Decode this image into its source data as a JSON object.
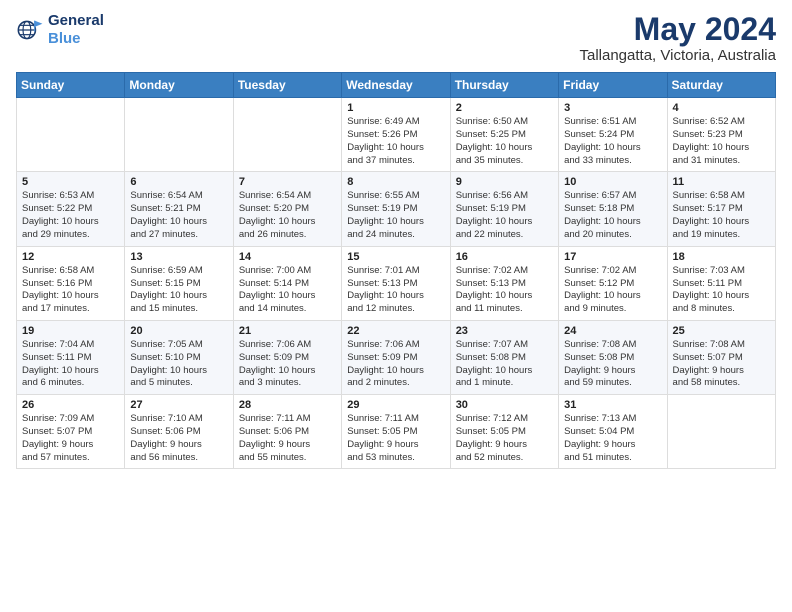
{
  "header": {
    "logo_line1": "General",
    "logo_line2": "Blue",
    "title": "May 2024",
    "subtitle": "Tallangatta, Victoria, Australia"
  },
  "calendar": {
    "days_of_week": [
      "Sunday",
      "Monday",
      "Tuesday",
      "Wednesday",
      "Thursday",
      "Friday",
      "Saturday"
    ],
    "weeks": [
      [
        {
          "day": "",
          "info": ""
        },
        {
          "day": "",
          "info": ""
        },
        {
          "day": "",
          "info": ""
        },
        {
          "day": "1",
          "info": "Sunrise: 6:49 AM\nSunset: 5:26 PM\nDaylight: 10 hours\nand 37 minutes."
        },
        {
          "day": "2",
          "info": "Sunrise: 6:50 AM\nSunset: 5:25 PM\nDaylight: 10 hours\nand 35 minutes."
        },
        {
          "day": "3",
          "info": "Sunrise: 6:51 AM\nSunset: 5:24 PM\nDaylight: 10 hours\nand 33 minutes."
        },
        {
          "day": "4",
          "info": "Sunrise: 6:52 AM\nSunset: 5:23 PM\nDaylight: 10 hours\nand 31 minutes."
        }
      ],
      [
        {
          "day": "5",
          "info": "Sunrise: 6:53 AM\nSunset: 5:22 PM\nDaylight: 10 hours\nand 29 minutes."
        },
        {
          "day": "6",
          "info": "Sunrise: 6:54 AM\nSunset: 5:21 PM\nDaylight: 10 hours\nand 27 minutes."
        },
        {
          "day": "7",
          "info": "Sunrise: 6:54 AM\nSunset: 5:20 PM\nDaylight: 10 hours\nand 26 minutes."
        },
        {
          "day": "8",
          "info": "Sunrise: 6:55 AM\nSunset: 5:19 PM\nDaylight: 10 hours\nand 24 minutes."
        },
        {
          "day": "9",
          "info": "Sunrise: 6:56 AM\nSunset: 5:19 PM\nDaylight: 10 hours\nand 22 minutes."
        },
        {
          "day": "10",
          "info": "Sunrise: 6:57 AM\nSunset: 5:18 PM\nDaylight: 10 hours\nand 20 minutes."
        },
        {
          "day": "11",
          "info": "Sunrise: 6:58 AM\nSunset: 5:17 PM\nDaylight: 10 hours\nand 19 minutes."
        }
      ],
      [
        {
          "day": "12",
          "info": "Sunrise: 6:58 AM\nSunset: 5:16 PM\nDaylight: 10 hours\nand 17 minutes."
        },
        {
          "day": "13",
          "info": "Sunrise: 6:59 AM\nSunset: 5:15 PM\nDaylight: 10 hours\nand 15 minutes."
        },
        {
          "day": "14",
          "info": "Sunrise: 7:00 AM\nSunset: 5:14 PM\nDaylight: 10 hours\nand 14 minutes."
        },
        {
          "day": "15",
          "info": "Sunrise: 7:01 AM\nSunset: 5:13 PM\nDaylight: 10 hours\nand 12 minutes."
        },
        {
          "day": "16",
          "info": "Sunrise: 7:02 AM\nSunset: 5:13 PM\nDaylight: 10 hours\nand 11 minutes."
        },
        {
          "day": "17",
          "info": "Sunrise: 7:02 AM\nSunset: 5:12 PM\nDaylight: 10 hours\nand 9 minutes."
        },
        {
          "day": "18",
          "info": "Sunrise: 7:03 AM\nSunset: 5:11 PM\nDaylight: 10 hours\nand 8 minutes."
        }
      ],
      [
        {
          "day": "19",
          "info": "Sunrise: 7:04 AM\nSunset: 5:11 PM\nDaylight: 10 hours\nand 6 minutes."
        },
        {
          "day": "20",
          "info": "Sunrise: 7:05 AM\nSunset: 5:10 PM\nDaylight: 10 hours\nand 5 minutes."
        },
        {
          "day": "21",
          "info": "Sunrise: 7:06 AM\nSunset: 5:09 PM\nDaylight: 10 hours\nand 3 minutes."
        },
        {
          "day": "22",
          "info": "Sunrise: 7:06 AM\nSunset: 5:09 PM\nDaylight: 10 hours\nand 2 minutes."
        },
        {
          "day": "23",
          "info": "Sunrise: 7:07 AM\nSunset: 5:08 PM\nDaylight: 10 hours\nand 1 minute."
        },
        {
          "day": "24",
          "info": "Sunrise: 7:08 AM\nSunset: 5:08 PM\nDaylight: 9 hours\nand 59 minutes."
        },
        {
          "day": "25",
          "info": "Sunrise: 7:08 AM\nSunset: 5:07 PM\nDaylight: 9 hours\nand 58 minutes."
        }
      ],
      [
        {
          "day": "26",
          "info": "Sunrise: 7:09 AM\nSunset: 5:07 PM\nDaylight: 9 hours\nand 57 minutes."
        },
        {
          "day": "27",
          "info": "Sunrise: 7:10 AM\nSunset: 5:06 PM\nDaylight: 9 hours\nand 56 minutes."
        },
        {
          "day": "28",
          "info": "Sunrise: 7:11 AM\nSunset: 5:06 PM\nDaylight: 9 hours\nand 55 minutes."
        },
        {
          "day": "29",
          "info": "Sunrise: 7:11 AM\nSunset: 5:05 PM\nDaylight: 9 hours\nand 53 minutes."
        },
        {
          "day": "30",
          "info": "Sunrise: 7:12 AM\nSunset: 5:05 PM\nDaylight: 9 hours\nand 52 minutes."
        },
        {
          "day": "31",
          "info": "Sunrise: 7:13 AM\nSunset: 5:04 PM\nDaylight: 9 hours\nand 51 minutes."
        },
        {
          "day": "",
          "info": ""
        }
      ]
    ]
  }
}
